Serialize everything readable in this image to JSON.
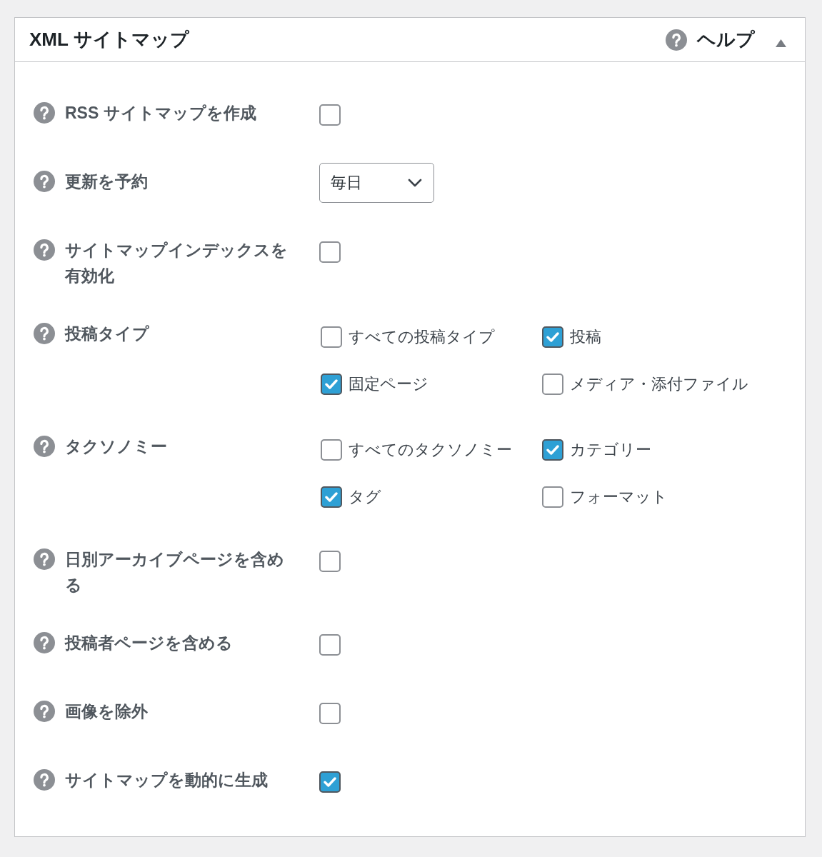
{
  "panel": {
    "title": "XML サイトマップ",
    "help_link": "ヘルプ",
    "expanded": true
  },
  "settings": [
    {
      "label": "RSS サイトマップを作成",
      "kind": "checkbox",
      "checked": false
    },
    {
      "label": "更新を予約",
      "kind": "select",
      "value": "毎日"
    },
    {
      "label": "サイトマップインデックスを有効化",
      "kind": "checkbox",
      "checked": false
    },
    {
      "label": "投稿タイプ",
      "kind": "checkbox_group",
      "options": [
        {
          "label": "すべての投稿タイプ",
          "checked": false
        },
        {
          "label": "投稿",
          "checked": true
        },
        {
          "label": "固定ページ",
          "checked": true
        },
        {
          "label": "メディア・添付ファイル",
          "checked": false
        }
      ]
    },
    {
      "label": "タクソノミー",
      "kind": "checkbox_group",
      "options": [
        {
          "label": "すべてのタクソノミー",
          "checked": false
        },
        {
          "label": "カテゴリー",
          "checked": true
        },
        {
          "label": "タグ",
          "checked": true
        },
        {
          "label": "フォーマット",
          "checked": false
        }
      ]
    },
    {
      "label": "日別アーカイブページを含める",
      "kind": "checkbox",
      "checked": false
    },
    {
      "label": "投稿者ページを含める",
      "kind": "checkbox",
      "checked": false
    },
    {
      "label": "画像を除外",
      "kind": "checkbox",
      "checked": false
    },
    {
      "label": "サイトマップを動的に生成",
      "kind": "checkbox",
      "checked": true
    }
  ]
}
